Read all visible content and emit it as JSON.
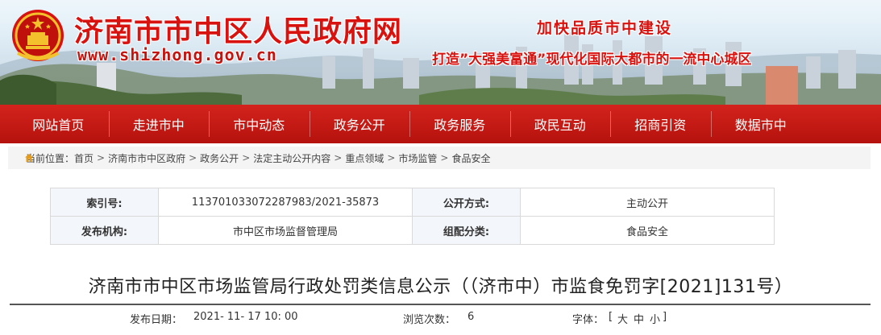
{
  "header": {
    "title": "济南市市中区人民政府网",
    "url": "www.shizhong.gov.cn",
    "slogan_main": "加快品质市中建设",
    "slogan_sub": "打造”大强美富通”现代化国际大都市的一流中心城区"
  },
  "nav": {
    "items": [
      {
        "label": "网站首页"
      },
      {
        "label": "走进市中"
      },
      {
        "label": "市中动态"
      },
      {
        "label": "政务公开"
      },
      {
        "label": "政务服务"
      },
      {
        "label": "政民互动"
      },
      {
        "label": "招商引资"
      },
      {
        "label": "数据市中"
      }
    ]
  },
  "breadcrumb": {
    "prefix": "当前位置：",
    "items": [
      "首页",
      "济南市市中区政府",
      "政务公开",
      "法定主动公开内容",
      "重点领域",
      "市场监管",
      "食品安全"
    ],
    "separator": ">"
  },
  "info": {
    "index_label": "索引号:",
    "index_value": "113701033072287983/2021-35873",
    "publish_mode_label": "公开方式:",
    "publish_mode_value": "主动公开",
    "agency_label": "发布机构:",
    "agency_value": "市中区市场监督管理局",
    "category_label": "组配分类:",
    "category_value": "食品安全"
  },
  "article": {
    "title": "济南市市中区市场监管局行政处罚类信息公示（（济市中）市监食免罚字[2021]131号）",
    "date_label": "发布日期：",
    "date_value": "2021- 11- 17 10: 00",
    "views_label": "浏览次数：",
    "views_value": "6",
    "font_label": "字体：",
    "font_open": "[",
    "font_large": "大",
    "font_medium": "中",
    "font_small": "小",
    "font_close": "]"
  },
  "colors": {
    "brand_red": "#d8120f",
    "nav_red": "#c41a14"
  }
}
